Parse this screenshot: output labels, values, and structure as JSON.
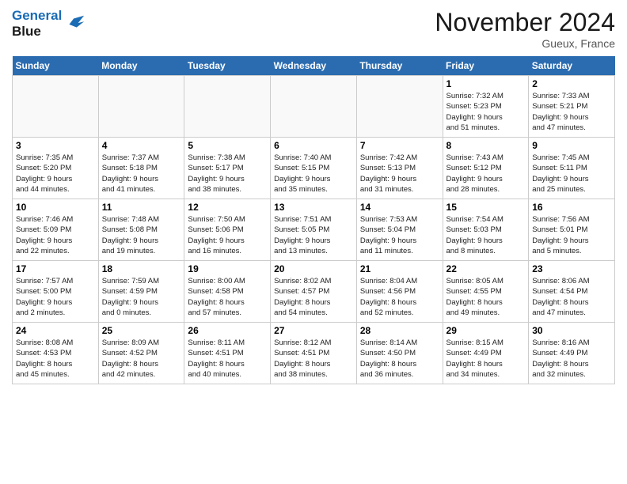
{
  "header": {
    "logo_line1": "General",
    "logo_line2": "Blue",
    "month_title": "November 2024",
    "location": "Gueux, France"
  },
  "weekdays": [
    "Sunday",
    "Monday",
    "Tuesday",
    "Wednesday",
    "Thursday",
    "Friday",
    "Saturday"
  ],
  "weeks": [
    [
      {
        "day": "",
        "info": ""
      },
      {
        "day": "",
        "info": ""
      },
      {
        "day": "",
        "info": ""
      },
      {
        "day": "",
        "info": ""
      },
      {
        "day": "",
        "info": ""
      },
      {
        "day": "1",
        "info": "Sunrise: 7:32 AM\nSunset: 5:23 PM\nDaylight: 9 hours\nand 51 minutes."
      },
      {
        "day": "2",
        "info": "Sunrise: 7:33 AM\nSunset: 5:21 PM\nDaylight: 9 hours\nand 47 minutes."
      }
    ],
    [
      {
        "day": "3",
        "info": "Sunrise: 7:35 AM\nSunset: 5:20 PM\nDaylight: 9 hours\nand 44 minutes."
      },
      {
        "day": "4",
        "info": "Sunrise: 7:37 AM\nSunset: 5:18 PM\nDaylight: 9 hours\nand 41 minutes."
      },
      {
        "day": "5",
        "info": "Sunrise: 7:38 AM\nSunset: 5:17 PM\nDaylight: 9 hours\nand 38 minutes."
      },
      {
        "day": "6",
        "info": "Sunrise: 7:40 AM\nSunset: 5:15 PM\nDaylight: 9 hours\nand 35 minutes."
      },
      {
        "day": "7",
        "info": "Sunrise: 7:42 AM\nSunset: 5:13 PM\nDaylight: 9 hours\nand 31 minutes."
      },
      {
        "day": "8",
        "info": "Sunrise: 7:43 AM\nSunset: 5:12 PM\nDaylight: 9 hours\nand 28 minutes."
      },
      {
        "day": "9",
        "info": "Sunrise: 7:45 AM\nSunset: 5:11 PM\nDaylight: 9 hours\nand 25 minutes."
      }
    ],
    [
      {
        "day": "10",
        "info": "Sunrise: 7:46 AM\nSunset: 5:09 PM\nDaylight: 9 hours\nand 22 minutes."
      },
      {
        "day": "11",
        "info": "Sunrise: 7:48 AM\nSunset: 5:08 PM\nDaylight: 9 hours\nand 19 minutes."
      },
      {
        "day": "12",
        "info": "Sunrise: 7:50 AM\nSunset: 5:06 PM\nDaylight: 9 hours\nand 16 minutes."
      },
      {
        "day": "13",
        "info": "Sunrise: 7:51 AM\nSunset: 5:05 PM\nDaylight: 9 hours\nand 13 minutes."
      },
      {
        "day": "14",
        "info": "Sunrise: 7:53 AM\nSunset: 5:04 PM\nDaylight: 9 hours\nand 11 minutes."
      },
      {
        "day": "15",
        "info": "Sunrise: 7:54 AM\nSunset: 5:03 PM\nDaylight: 9 hours\nand 8 minutes."
      },
      {
        "day": "16",
        "info": "Sunrise: 7:56 AM\nSunset: 5:01 PM\nDaylight: 9 hours\nand 5 minutes."
      }
    ],
    [
      {
        "day": "17",
        "info": "Sunrise: 7:57 AM\nSunset: 5:00 PM\nDaylight: 9 hours\nand 2 minutes."
      },
      {
        "day": "18",
        "info": "Sunrise: 7:59 AM\nSunset: 4:59 PM\nDaylight: 9 hours\nand 0 minutes."
      },
      {
        "day": "19",
        "info": "Sunrise: 8:00 AM\nSunset: 4:58 PM\nDaylight: 8 hours\nand 57 minutes."
      },
      {
        "day": "20",
        "info": "Sunrise: 8:02 AM\nSunset: 4:57 PM\nDaylight: 8 hours\nand 54 minutes."
      },
      {
        "day": "21",
        "info": "Sunrise: 8:04 AM\nSunset: 4:56 PM\nDaylight: 8 hours\nand 52 minutes."
      },
      {
        "day": "22",
        "info": "Sunrise: 8:05 AM\nSunset: 4:55 PM\nDaylight: 8 hours\nand 49 minutes."
      },
      {
        "day": "23",
        "info": "Sunrise: 8:06 AM\nSunset: 4:54 PM\nDaylight: 8 hours\nand 47 minutes."
      }
    ],
    [
      {
        "day": "24",
        "info": "Sunrise: 8:08 AM\nSunset: 4:53 PM\nDaylight: 8 hours\nand 45 minutes."
      },
      {
        "day": "25",
        "info": "Sunrise: 8:09 AM\nSunset: 4:52 PM\nDaylight: 8 hours\nand 42 minutes."
      },
      {
        "day": "26",
        "info": "Sunrise: 8:11 AM\nSunset: 4:51 PM\nDaylight: 8 hours\nand 40 minutes."
      },
      {
        "day": "27",
        "info": "Sunrise: 8:12 AM\nSunset: 4:51 PM\nDaylight: 8 hours\nand 38 minutes."
      },
      {
        "day": "28",
        "info": "Sunrise: 8:14 AM\nSunset: 4:50 PM\nDaylight: 8 hours\nand 36 minutes."
      },
      {
        "day": "29",
        "info": "Sunrise: 8:15 AM\nSunset: 4:49 PM\nDaylight: 8 hours\nand 34 minutes."
      },
      {
        "day": "30",
        "info": "Sunrise: 8:16 AM\nSunset: 4:49 PM\nDaylight: 8 hours\nand 32 minutes."
      }
    ]
  ]
}
